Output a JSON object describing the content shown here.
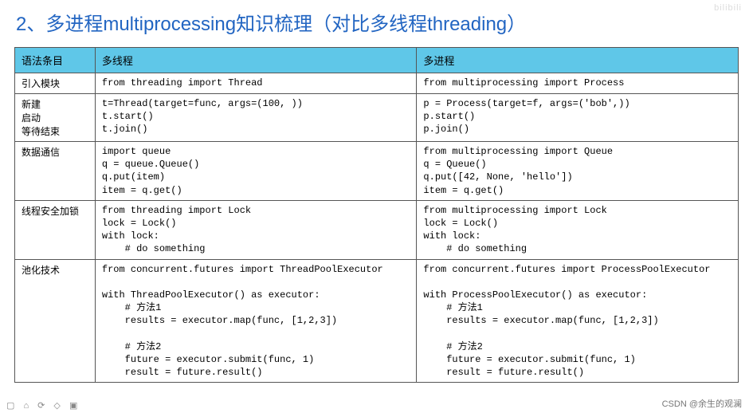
{
  "title": "2、多进程multiprocessing知识梳理（对比多线程threading）",
  "headers": {
    "c0": "语法条目",
    "c1": "多线程",
    "c2": "多进程"
  },
  "rows": [
    {
      "label": "引入模块",
      "thread": "from threading import Thread",
      "process": "from multiprocessing import Process"
    },
    {
      "label": "新建\n启动\n等待结束",
      "thread": "t=Thread(target=func, args=(100, ))\nt.start()\nt.join()",
      "process": "p = Process(target=f, args=('bob',))\np.start()\np.join()"
    },
    {
      "label": "数据通信",
      "thread": "import queue\nq = queue.Queue()\nq.put(item)\nitem = q.get()",
      "process": "from multiprocessing import Queue\nq = Queue()\nq.put([42, None, 'hello'])\nitem = q.get()"
    },
    {
      "label": "线程安全加锁",
      "thread": "from threading import Lock\nlock = Lock()\nwith lock:\n    # do something",
      "process": "from multiprocessing import Lock\nlock = Lock()\nwith lock:\n    # do something"
    },
    {
      "label": "池化技术",
      "thread": "from concurrent.futures import ThreadPoolExecutor\n\nwith ThreadPoolExecutor() as executor:\n    # 方法1\n    results = executor.map(func, [1,2,3])\n\n    # 方法2\n    future = executor.submit(func, 1)\n    result = future.result()",
      "process": "from concurrent.futures import ProcessPoolExecutor\n\nwith ProcessPoolExecutor() as executor:\n    # 方法1\n    results = executor.map(func, [1,2,3])\n\n    # 方法2\n    future = executor.submit(func, 1)\n    result = future.result()"
    }
  ],
  "watermark_br": "CSDN @余生的观澜",
  "watermark_tr": "bilibili",
  "toolbar_glyphs": "▢ ⌂ ⟳ ◇ ▣"
}
